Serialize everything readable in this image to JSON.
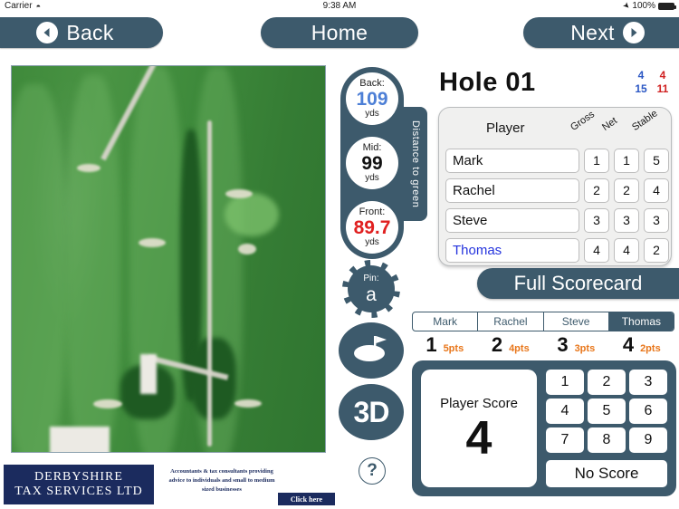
{
  "statusbar": {
    "carrier": "Carrier",
    "wifi_icon": "wifi-icon",
    "time": "9:38 AM",
    "location_icon": "location-arrow-icon",
    "battery_pct": "100%",
    "battery_icon": "battery-icon"
  },
  "nav": {
    "back": "Back",
    "home": "Home",
    "next": "Next",
    "back_icon": "chevron-left-circle-icon",
    "next_icon": "chevron-right-circle-icon"
  },
  "map": {
    "name": "hole-aerial-map"
  },
  "distances": {
    "tab_label": "Distance to green",
    "unit": "yds",
    "items": [
      {
        "label": "Back:",
        "value": "109",
        "unit": "yds",
        "color": "#4d7fd6"
      },
      {
        "label": "Mid:",
        "value": "99",
        "unit": "yds",
        "color": "#111111"
      },
      {
        "label": "Front:",
        "value": "89.7",
        "unit": "yds",
        "color": "#e02020"
      }
    ]
  },
  "pin": {
    "label": "Pin:",
    "value": "a"
  },
  "tools": {
    "green_icon": "green-flag-icon",
    "three_d": "3D",
    "help": "?"
  },
  "hole": {
    "title": "Hole 01",
    "stats": {
      "par_blue": "4",
      "par_red": "4",
      "si_blue": "15",
      "si_red": "11"
    }
  },
  "scorecard": {
    "col_player": "Player",
    "col_gross": "Gross",
    "col_net": "Net",
    "col_stable": "Stable",
    "rows": [
      {
        "player": "Mark",
        "gross": "1",
        "net": "1",
        "stable": "5",
        "active": false
      },
      {
        "player": "Rachel",
        "gross": "2",
        "net": "2",
        "stable": "4",
        "active": false
      },
      {
        "player": "Steve",
        "gross": "3",
        "net": "3",
        "stable": "3",
        "active": false
      },
      {
        "player": "Thomas",
        "gross": "4",
        "net": "4",
        "stable": "2",
        "active": true
      }
    ],
    "full_scorecard": "Full Scorecard"
  },
  "segments": [
    {
      "label": "Mark",
      "selected": false
    },
    {
      "label": "Rachel",
      "selected": false
    },
    {
      "label": "Steve",
      "selected": false
    },
    {
      "label": "Thomas",
      "selected": true
    }
  ],
  "points_row": [
    {
      "score": "1",
      "pts": "5pts"
    },
    {
      "score": "2",
      "pts": "4pts"
    },
    {
      "score": "3",
      "pts": "3pts"
    },
    {
      "score": "4",
      "pts": "2pts"
    }
  ],
  "keypad": {
    "score_label": "Player Score",
    "score_value": "4",
    "keys": [
      "1",
      "2",
      "3",
      "4",
      "5",
      "6",
      "7",
      "8",
      "9"
    ],
    "no_score": "No Score"
  },
  "ad": {
    "logo_line1": "DERBYSHIRE",
    "logo_line2": "TAX SERVICES LTD",
    "tagline": "Accountants & tax consultants providing advice to individuals and small to medium sized businesses",
    "cta": "Click here"
  },
  "colors": {
    "chrome": "#3d5a6c",
    "accent_orange": "#e8761a",
    "active_blue": "#2433dd",
    "front_red": "#e02020"
  }
}
